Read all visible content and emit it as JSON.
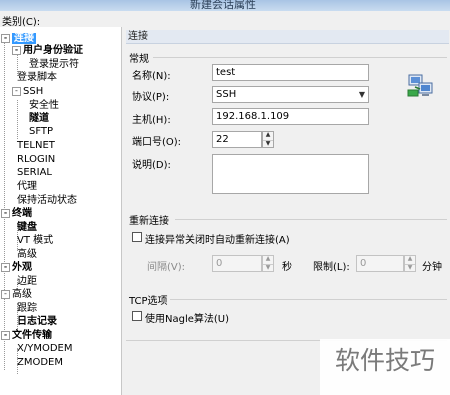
{
  "window": {
    "title": "新建会话属性"
  },
  "category_label": "类别(C):",
  "tree": [
    {
      "id": "connection",
      "label": "连接",
      "bold": true,
      "selected": true,
      "expander": "-"
    },
    {
      "id": "auth",
      "label": "用户身份验证",
      "bold": true,
      "expander": "-"
    },
    {
      "id": "login-prompts",
      "label": "登录提示符"
    },
    {
      "id": "login-script",
      "label": "登录脚本"
    },
    {
      "id": "ssh",
      "label": "SSH",
      "expander": "-"
    },
    {
      "id": "security",
      "label": "安全性"
    },
    {
      "id": "tunnel",
      "label": "隧道",
      "bold": true
    },
    {
      "id": "sftp",
      "label": "SFTP"
    },
    {
      "id": "telnet",
      "label": "TELNET"
    },
    {
      "id": "rlogin",
      "label": "RLOGIN"
    },
    {
      "id": "serial",
      "label": "SERIAL"
    },
    {
      "id": "proxy",
      "label": "代理"
    },
    {
      "id": "keepalive",
      "label": "保持活动状态"
    },
    {
      "id": "terminal",
      "label": "终端",
      "bold": true,
      "expander": "-"
    },
    {
      "id": "keyboard",
      "label": "键盘",
      "bold": true
    },
    {
      "id": "vt-mode",
      "label": "VT 模式"
    },
    {
      "id": "advanced-term",
      "label": "高级"
    },
    {
      "id": "appearance",
      "label": "外观",
      "bold": true,
      "expander": "-"
    },
    {
      "id": "margins",
      "label": "边距"
    },
    {
      "id": "advanced",
      "label": "高级",
      "expander": "-"
    },
    {
      "id": "tracking",
      "label": "跟踪"
    },
    {
      "id": "logging",
      "label": "日志记录",
      "bold": true
    },
    {
      "id": "file-transfer",
      "label": "文件传输",
      "bold": true,
      "expander": "-"
    },
    {
      "id": "xymodem",
      "label": "X/YMODEM"
    },
    {
      "id": "zmodem",
      "label": "ZMODEM"
    }
  ],
  "panel": {
    "header": "连接",
    "general": {
      "title": "常规",
      "name_label": "名称(N):",
      "name_value": "test",
      "protocol_label": "协议(P):",
      "protocol_value": "SSH",
      "host_label": "主机(H):",
      "host_value": "192.168.1.109",
      "port_label": "端口号(O):",
      "port_value": "22",
      "desc_label": "说明(D):",
      "desc_value": ""
    },
    "reconnect": {
      "title": "重新连接",
      "auto_label": "连接异常关闭时自动重新连接(A)",
      "auto_checked": false,
      "interval_label": "间隔(V):",
      "interval_value": "0",
      "interval_unit": "秒",
      "limit_label": "限制(L):",
      "limit_value": "0",
      "limit_unit": "分钟"
    },
    "tcp": {
      "title": "TCP选项",
      "nagle_label": "使用Nagle算法(U)",
      "nagle_checked": false
    }
  },
  "watermark": "软件技巧",
  "icons": {
    "session": "network-computers-icon"
  }
}
